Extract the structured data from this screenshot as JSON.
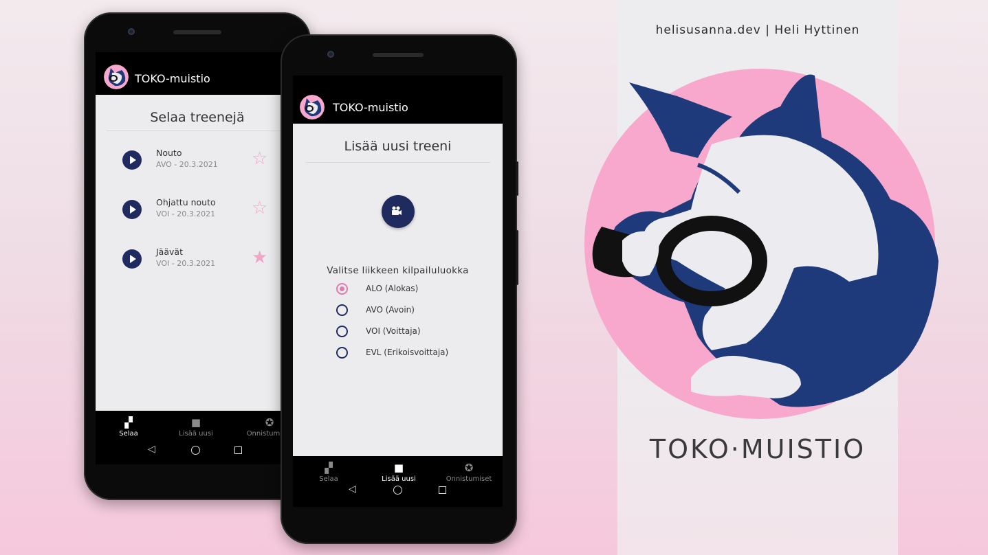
{
  "credit": "helisusanna.dev | Heli Hyttinen",
  "brand": "TOKO·MUISTIO",
  "colors": {
    "accent_navy": "#1f2a5e",
    "accent_pink": "#f0a6c6",
    "radio_pink": "#e07bb0"
  },
  "app_title": "TOKO-muistio",
  "browse_screen": {
    "title": "Selaa treenejä",
    "items": [
      {
        "title": "Nouto",
        "subtitle": "AVO - 20.3.2021",
        "favorite": false
      },
      {
        "title": "Ohjattu nouto",
        "subtitle": "VOI - 20.3.2021",
        "favorite": false
      },
      {
        "title": "Jäävät",
        "subtitle": "VOI - 20.3.2021",
        "favorite": true
      }
    ],
    "nav": [
      {
        "label": "Selaa",
        "icon": "dog-icon",
        "active": true
      },
      {
        "label": "Lisää uusi",
        "icon": "video-camera-icon",
        "active": false
      },
      {
        "label": "Onnistumiset",
        "icon": "star-circle-icon",
        "active": false
      }
    ]
  },
  "add_screen": {
    "title": "Lisää uusi treeni",
    "question": "Valitse liikkeen kilpailuluokka",
    "options": [
      {
        "label": "ALO (Alokas)",
        "checked": true
      },
      {
        "label": "AVO (Avoin)",
        "checked": false
      },
      {
        "label": "VOI (Voittaja)",
        "checked": false
      },
      {
        "label": "EVL (Erikoisvoittaja)",
        "checked": false
      }
    ],
    "nav": [
      {
        "label": "Selaa",
        "icon": "dog-icon",
        "active": false
      },
      {
        "label": "Lisää uusi",
        "icon": "video-camera-icon",
        "active": true
      },
      {
        "label": "Onnistumiset",
        "icon": "star-circle-icon",
        "active": false
      }
    ]
  },
  "system_nav": {
    "back": "◁",
    "home": "home",
    "recents": "recents"
  }
}
